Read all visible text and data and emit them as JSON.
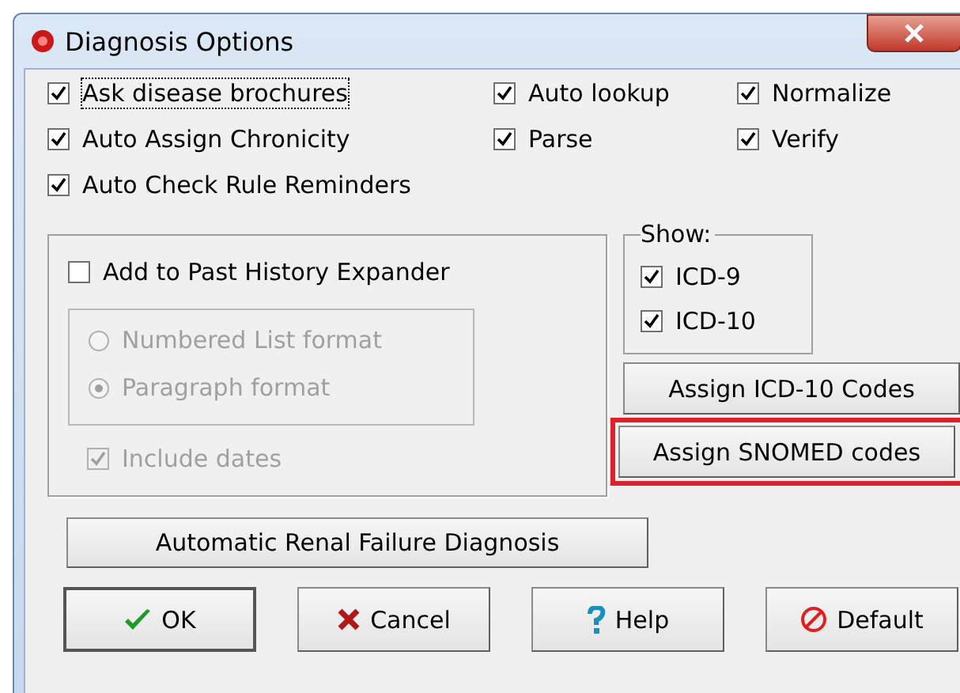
{
  "window": {
    "title": "Diagnosis Options"
  },
  "options": [
    {
      "label": "Ask disease brochures",
      "checked": true,
      "focused": true
    },
    {
      "label": "Auto lookup",
      "checked": true,
      "focused": false
    },
    {
      "label": "Normalize",
      "checked": true,
      "focused": false
    },
    {
      "label": "Auto Assign Chronicity",
      "checked": true,
      "focused": false
    },
    {
      "label": "Parse",
      "checked": true,
      "focused": false
    },
    {
      "label": "Verify",
      "checked": true,
      "focused": false
    },
    {
      "label": "Auto Check Rule Reminders",
      "checked": true,
      "focused": false
    }
  ],
  "history": {
    "checkbox": {
      "label": "Add to Past History Expander",
      "checked": false
    },
    "format_options": [
      {
        "label": "Numbered List format",
        "selected": false,
        "disabled": true
      },
      {
        "label": "Paragraph format",
        "selected": true,
        "disabled": true
      }
    ],
    "include_dates": {
      "label": "Include dates",
      "checked": true,
      "disabled": true
    }
  },
  "show": {
    "legend": "Show:",
    "items": [
      {
        "label": "ICD-9",
        "checked": true
      },
      {
        "label": "ICD-10",
        "checked": true
      }
    ]
  },
  "code_buttons": [
    {
      "label": "Assign ICD-10 Codes",
      "highlighted": false
    },
    {
      "label": "Assign SNOMED codes",
      "highlighted": true
    }
  ],
  "renal_button": {
    "label": "Automatic Renal Failure Diagnosis"
  },
  "footer_buttons": [
    {
      "label": "OK",
      "kind": "ok",
      "default": true
    },
    {
      "label": "Cancel",
      "kind": "cancel",
      "default": false
    },
    {
      "label": "Help",
      "kind": "help",
      "default": false
    },
    {
      "label": "Default",
      "kind": "default",
      "default": false
    }
  ]
}
